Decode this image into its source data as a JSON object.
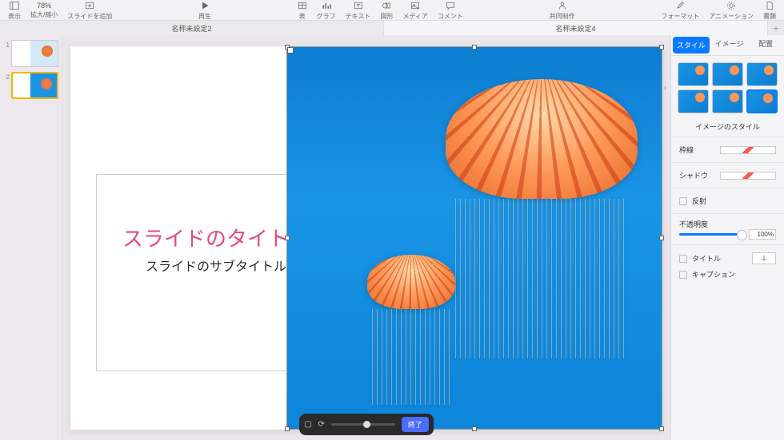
{
  "toolbar": {
    "view_label": "表示",
    "zoom_value": "78%",
    "zoom_label": "拡大/縮小",
    "add_slide_label": "スライドを追加",
    "play_label": "再生",
    "table_label": "表",
    "chart_label": "グラフ",
    "text_label": "テキスト",
    "shape_label": "図形",
    "media_label": "メディア",
    "comment_label": "コメント",
    "collab_label": "共同制作",
    "format_label": "フォーマット",
    "animate_label": "アニメーション",
    "document_label": "書類"
  },
  "doc_tabs": {
    "tab1": "名称未設定2",
    "tab2": "名称未設定4"
  },
  "slide_nav": {
    "thumb1_num": "1",
    "thumb2_num": "2"
  },
  "slide": {
    "title": "スライドのタイトル",
    "subtitle": "スライドのサブタイトル"
  },
  "float_bar": {
    "done": "終了"
  },
  "inspector": {
    "tabs": {
      "style": "スタイル",
      "image": "イメージ",
      "arrange": "配置"
    },
    "style_title": "イメージのスタイル",
    "border_label": "枠線",
    "shadow_label": "シャドウ",
    "reflect_label": "反射",
    "opacity_label": "不透明度",
    "opacity_value": "100%",
    "title_cb": "タイトル",
    "caption_cb": "キャプション"
  }
}
